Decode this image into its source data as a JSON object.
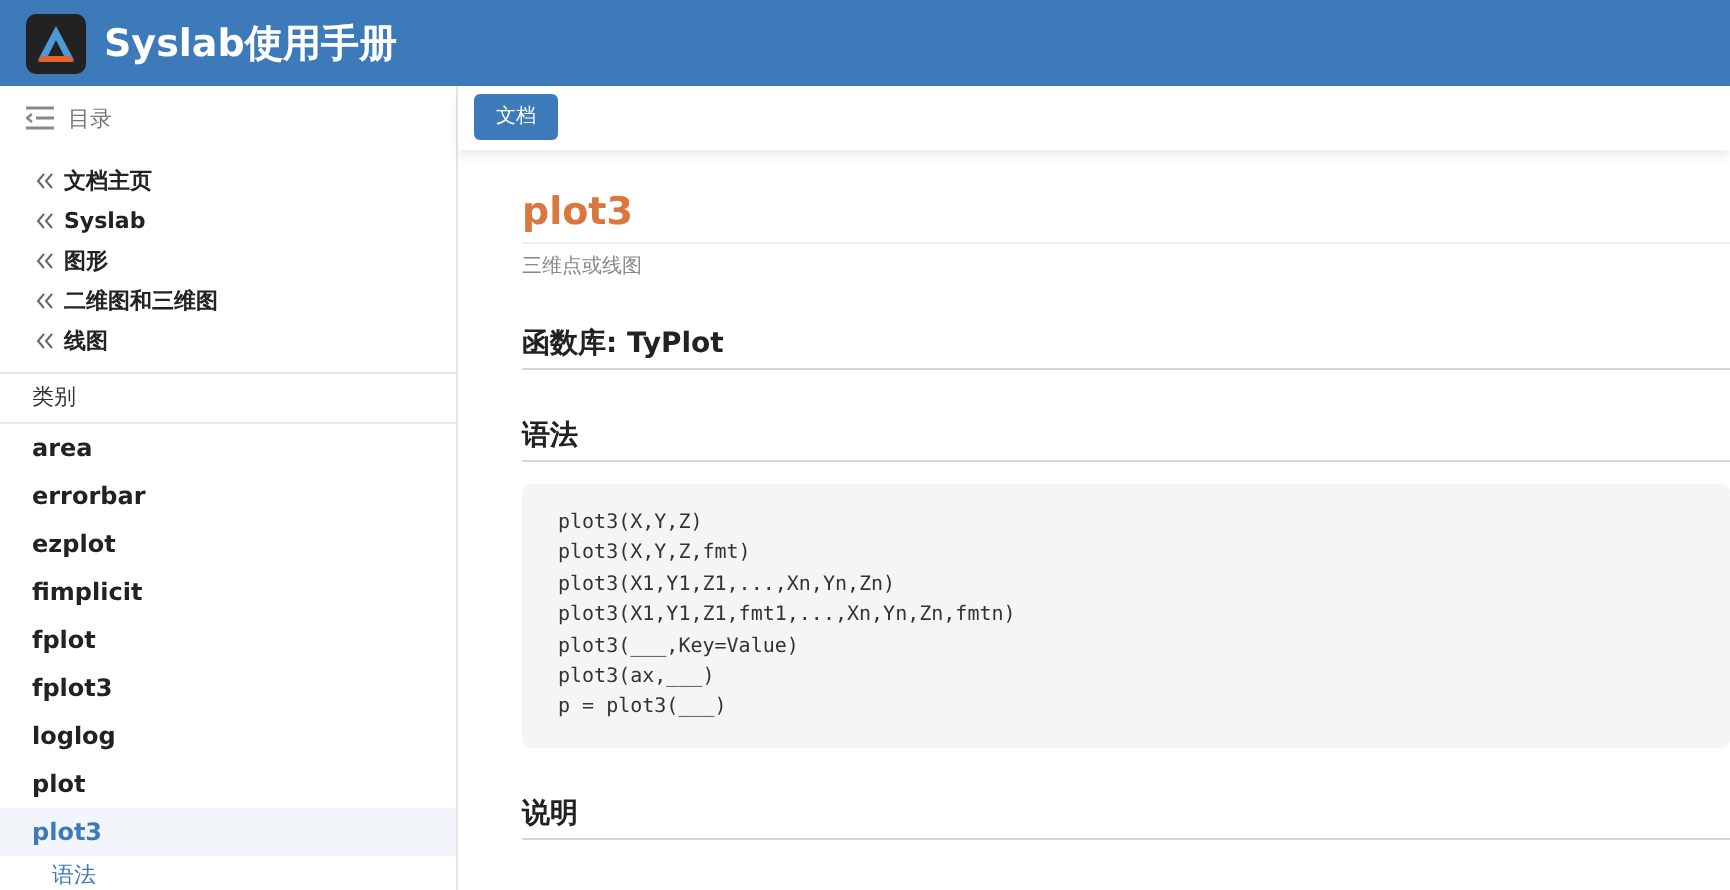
{
  "header": {
    "title": "Syslab使用手册"
  },
  "sidebar": {
    "toc_label": "目录",
    "breadcrumbs": [
      "文档主页",
      "Syslab",
      "图形",
      "二维图和三维图",
      "线图"
    ],
    "category_label": "类别",
    "items": [
      {
        "label": "area",
        "selected": false
      },
      {
        "label": "errorbar",
        "selected": false
      },
      {
        "label": "ezplot",
        "selected": false
      },
      {
        "label": "fimplicit",
        "selected": false
      },
      {
        "label": "fplot",
        "selected": false
      },
      {
        "label": "fplot3",
        "selected": false
      },
      {
        "label": "loglog",
        "selected": false
      },
      {
        "label": "plot",
        "selected": false
      },
      {
        "label": "plot3",
        "selected": true,
        "children": [
          {
            "label": "语法"
          }
        ]
      }
    ]
  },
  "toolbar": {
    "button": "文档"
  },
  "page": {
    "title": "plot3",
    "subtitle": "三维点或线图",
    "sections": [
      {
        "heading": "函数库: TyPlot"
      },
      {
        "heading": "语法",
        "code": [
          "plot3(X,Y,Z)",
          "plot3(X,Y,Z,fmt)",
          "plot3(X1,Y1,Z1,...,Xn,Yn,Zn)",
          "plot3(X1,Y1,Z1,fmt1,...,Xn,Yn,Zn,fmtn)",
          "plot3(___,Key=Value)",
          "plot3(ax,___)",
          "p = plot3(___)"
        ]
      },
      {
        "heading": "说明"
      }
    ]
  }
}
